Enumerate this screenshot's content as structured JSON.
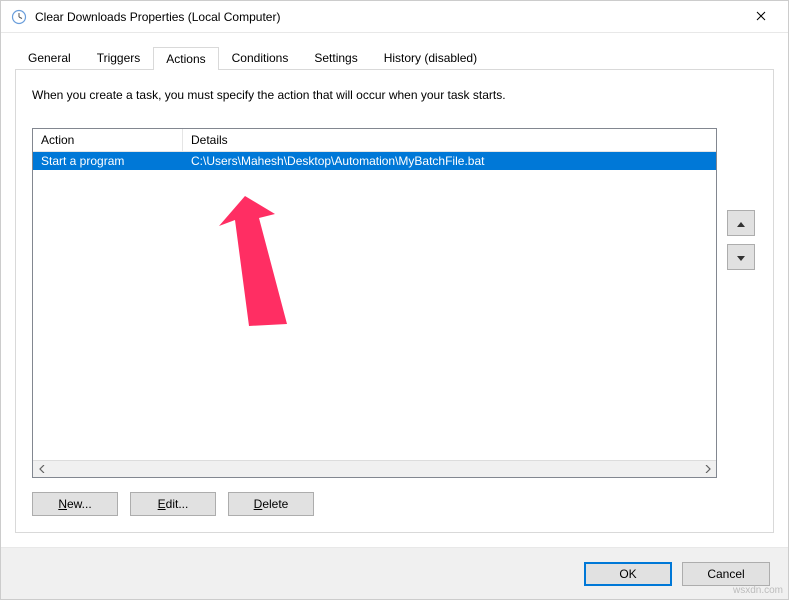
{
  "window": {
    "title": "Clear Downloads Properties (Local Computer)"
  },
  "tabs": {
    "items": [
      {
        "label": "General"
      },
      {
        "label": "Triggers"
      },
      {
        "label": "Actions"
      },
      {
        "label": "Conditions"
      },
      {
        "label": "Settings"
      },
      {
        "label": "History (disabled)"
      }
    ],
    "active_index": 2
  },
  "panel": {
    "instruction": "When you create a task, you must specify the action that will occur when your task starts.",
    "columns": {
      "action": "Action",
      "details": "Details"
    },
    "rows": [
      {
        "action": "Start a program",
        "details": "C:\\Users\\Mahesh\\Desktop\\Automation\\MyBatchFile.bat",
        "selected": true
      }
    ],
    "buttons": {
      "new": "New...",
      "edit": "Edit...",
      "delete": "Delete"
    }
  },
  "footer": {
    "ok": "OK",
    "cancel": "Cancel"
  },
  "watermark": "wsxdn.com"
}
